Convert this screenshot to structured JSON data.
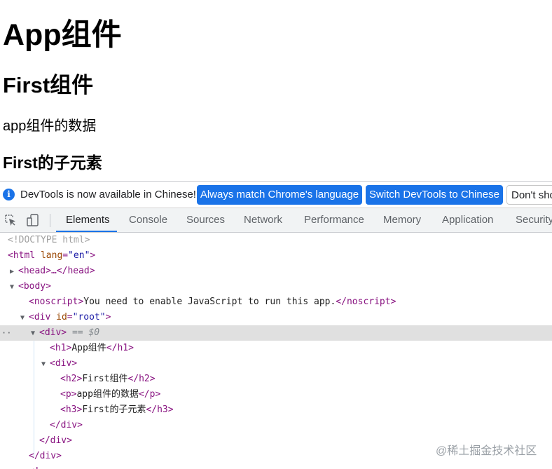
{
  "page": {
    "h1": "App组件",
    "h2": "First组件",
    "p": "app组件的数据",
    "h3": "First的子元素"
  },
  "devtools": {
    "infobar": {
      "message": "DevTools is now available in Chinese!",
      "match_button": "Always match Chrome's language",
      "switch_button": "Switch DevTools to Chinese",
      "dont_button": "Don't show again"
    },
    "tabs": [
      "Elements",
      "Console",
      "Sources",
      "Network",
      "Performance",
      "Memory",
      "Application",
      "Security"
    ],
    "active_tab": "Elements",
    "dom": {
      "doctype": "<!DOCTYPE html>",
      "html_open": "<html",
      "lang_attr": "lang",
      "lang_val": "\"en\"",
      "head_text": "<head>…</head>",
      "body_open": "<body>",
      "noscript_open": "<noscript>",
      "noscript_text": "You need to enable JavaScript to run this app.",
      "noscript_close": "</noscript>",
      "div_root_open": "<div",
      "id_attr": "id",
      "id_val": "\"root\"",
      "div_open": "<div>",
      "selected_marker": "== $0",
      "h1_open": "<h1>",
      "h1_text": "App组件",
      "h1_close": "</h1>",
      "inner_div_open": "<div>",
      "h2_open": "<h2>",
      "h2_text": "First组件",
      "h2_close": "</h2>",
      "p_open": "<p>",
      "p_text": "app组件的数据",
      "p_close": "</p>",
      "h3_open": "<h3>",
      "h3_text": "First的子元素",
      "h3_close": "</h3>",
      "div_close": "</div>",
      "partial": "<!"
    }
  },
  "watermark": "@稀土掘金技术社区",
  "colors": {
    "accent": "#1a73e8",
    "tag": "#881280",
    "attr": "#994500",
    "attr_value": "#1a1aa6"
  }
}
